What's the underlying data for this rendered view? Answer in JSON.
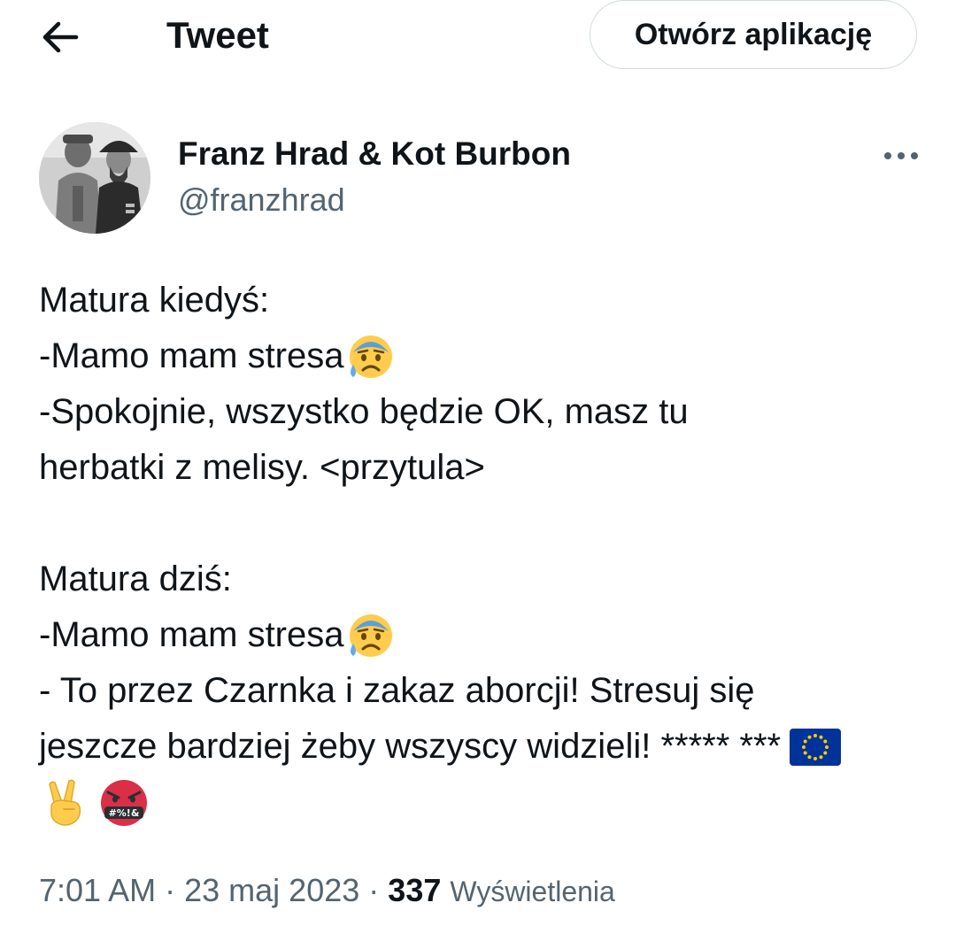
{
  "header": {
    "title": "Tweet",
    "open_app_label": "Otwórz aplikację",
    "back_icon": "arrow-left-icon"
  },
  "author": {
    "display_name": "Franz Hrad & Kot Burbon",
    "handle": "@franzhrad",
    "more_icon": "more-horizontal-icon"
  },
  "tweet": {
    "lines": [
      {
        "text": "Matura kiedyś:"
      },
      {
        "text": "-Mamo mam stresa",
        "emoji": "anxious-face-with-sweat"
      },
      {
        "text": "-Spokojnie, wszystko będzie OK, masz tu"
      },
      {
        "text": "herbatki z melisy. <przytula>"
      },
      {
        "text": ""
      },
      {
        "text": "Matura dziś:"
      },
      {
        "text": "-Mamo mam stresa",
        "emoji": "anxious-face-with-sweat"
      },
      {
        "text": "- To przez Czarnka i zakaz aborcji! Stresuj się"
      },
      {
        "text": "jeszcze bardziej żeby wszyscy widzieli! ***** ***",
        "emoji": "eu-flag"
      },
      {
        "text": "",
        "emoji": "victory-hand + face-with-symbols-on-mouth"
      }
    ],
    "time": "7:01 AM",
    "separator": "·",
    "date": "23 maj 2023",
    "views_count": "337",
    "views_label": "Wyświetlenia"
  },
  "colors": {
    "text_primary": "#0f1419",
    "text_secondary": "#536471",
    "border": "#cfd9de",
    "background": "#ffffff",
    "eu_blue": "#003399",
    "eu_star": "#ffcc00"
  }
}
